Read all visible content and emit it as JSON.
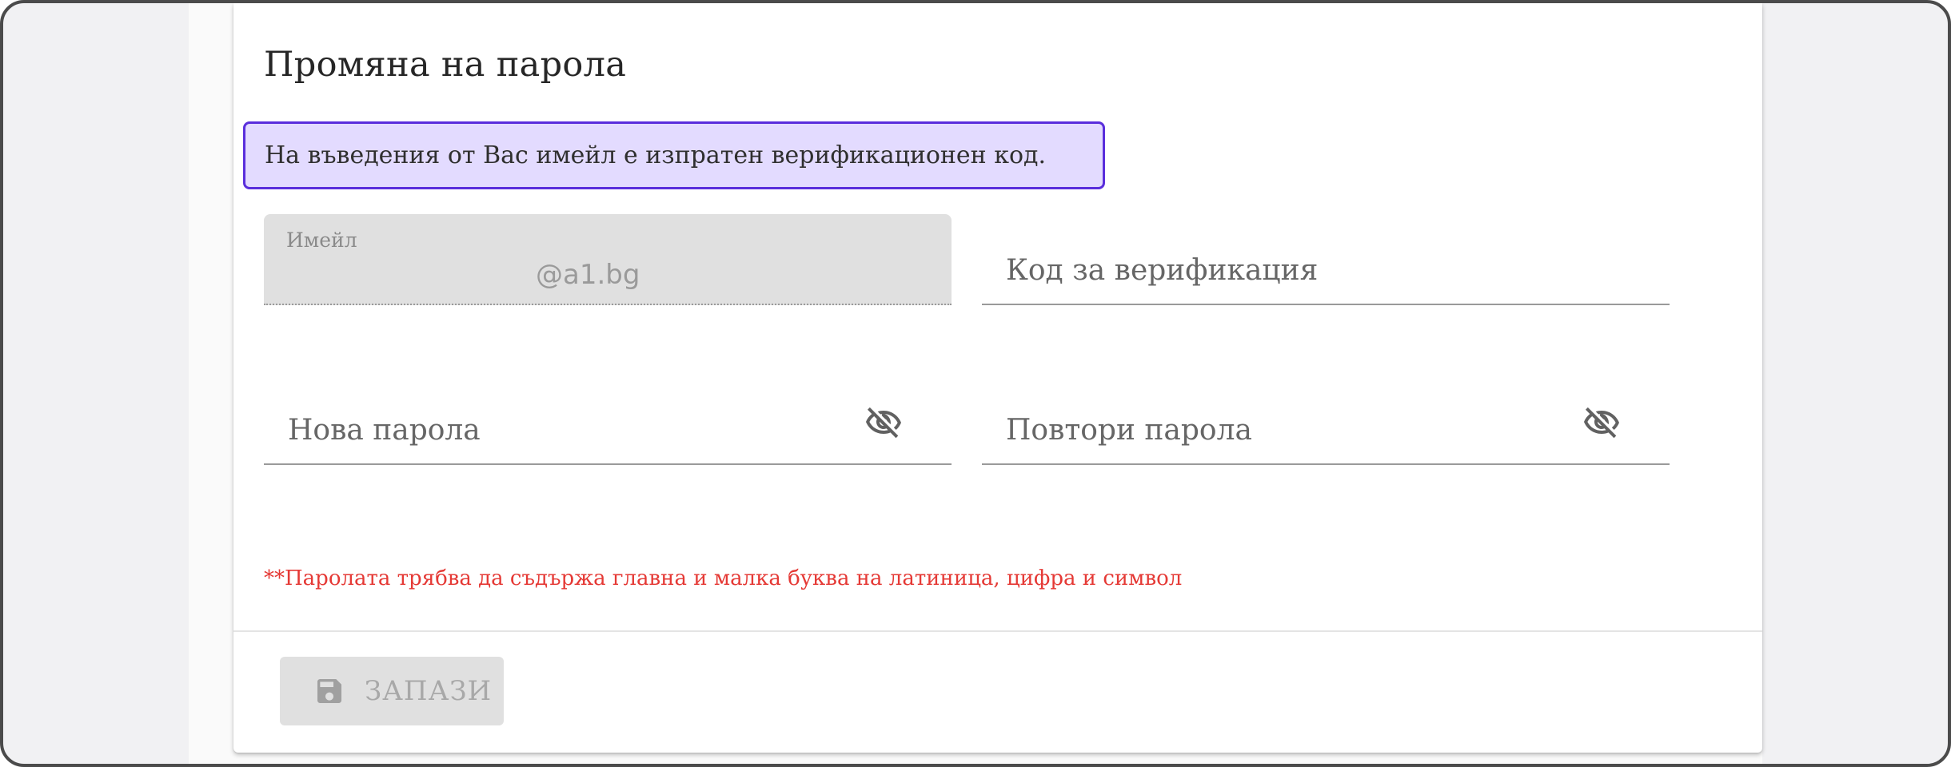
{
  "form": {
    "title": "Промяна на парола",
    "info_message": "На въведения от Вас имейл е изпратен верификационен код.",
    "email": {
      "label": "Имейл",
      "value": "@a1.bg"
    },
    "verification_code": {
      "placeholder": "Код за верификация",
      "value": ""
    },
    "new_password": {
      "placeholder": "Нова парола",
      "value": ""
    },
    "repeat_password": {
      "placeholder": "Повтори парола",
      "value": ""
    },
    "password_hint": "**Паролата трябва да съдържа главна и малка буква на латиница, цифра и символ",
    "save_label": "ЗАПАЗИ"
  },
  "icons": {
    "password_toggle": "eye-off-icon",
    "save": "floppy-disk-icon"
  },
  "colors": {
    "info_bg": "#e3dbff",
    "info_border": "#5a2edc",
    "hint": "#e53935",
    "disabled_button": "#e0e0e0"
  }
}
